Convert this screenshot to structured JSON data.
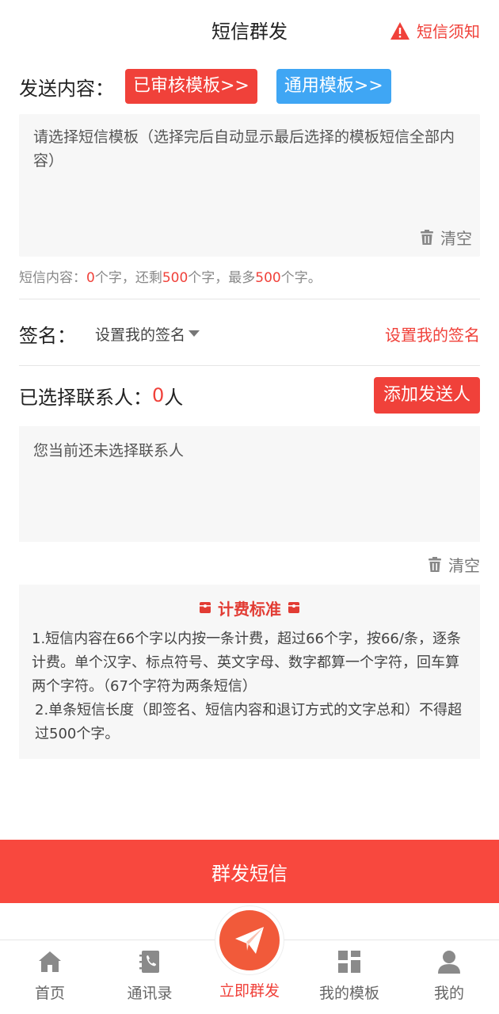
{
  "header": {
    "title": "短信群发",
    "notice_label": "短信须知"
  },
  "content": {
    "label": "发送内容：",
    "approved_template_button": "已审核模板>>",
    "common_template_button": "通用模板>>",
    "placeholder": "请选择短信模板（选择完后自动显示最后选择的模板短信全部内容）",
    "clear_label": "清空"
  },
  "count": {
    "prefix": "短信内容：",
    "current": "0",
    "mid1": "个字，还剩",
    "remaining": "500",
    "mid2": "个字，最多",
    "max": "500",
    "suffix": "个字。"
  },
  "signature": {
    "label": "签名：",
    "select_value": "设置我的签名",
    "link": "设置我的签名"
  },
  "contacts": {
    "label": "已选择联系人：",
    "count": "0",
    "unit": "人",
    "add_button": "添加发送人",
    "placeholder": "您当前还未选择联系人",
    "clear_label": "清空"
  },
  "fee": {
    "title": "计费标准",
    "line1": "1.短信内容在66个字以内按一条计费，超过66个字，按66/条，逐条计费。单个汉字、标点符号、英文字母、数字都算一个字符，回车算两个字符。（67个字符为两条短信）",
    "line2": "2.单条短信长度（即签名、短信内容和退订方式的文字总和）不得超过500个字。"
  },
  "send_button": "群发短信",
  "tabbar": {
    "items": [
      {
        "label": "首页",
        "icon": "home-icon"
      },
      {
        "label": "通讯录",
        "icon": "contacts-book-icon"
      },
      {
        "label": "立即群发",
        "icon": "paper-plane-icon"
      },
      {
        "label": "我的模板",
        "icon": "grid-icon"
      },
      {
        "label": "我的",
        "icon": "user-icon"
      }
    ],
    "active_color": "#f0413a",
    "inactive_color": "#8a8a8a"
  },
  "colors": {
    "accent_red": "#f0413a",
    "accent_blue": "#3fa6f4"
  }
}
